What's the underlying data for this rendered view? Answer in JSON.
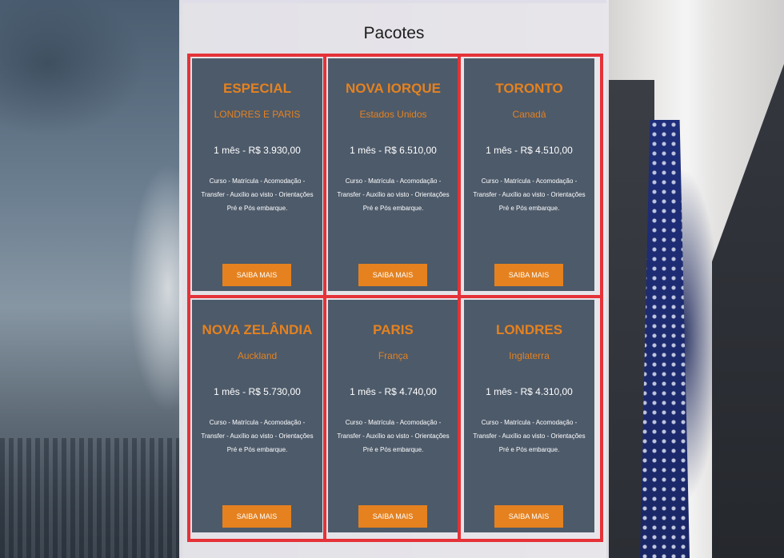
{
  "section_title": "Pacotes",
  "packages": [
    {
      "title": "ESPECIAL",
      "subtitle": "LONDRES E PARIS",
      "price": "1 mês - R$ 3.930,00",
      "description": "Curso - Matrícula - Acomodação - Transfer - Auxílio ao visto - Orientações Pré e Pós embarque.",
      "button_label": "SAIBA MAIS"
    },
    {
      "title": "NOVA IORQUE",
      "subtitle": "Estados Unidos",
      "price": "1 mês - R$ 6.510,00",
      "description": "Curso - Matrícula - Acomodação - Transfer - Auxílio ao visto - Orientações Pré e Pós embarque.",
      "button_label": "SAIBA MAIS"
    },
    {
      "title": "TORONTO",
      "subtitle": "Canadá",
      "price": "1 mês - R$ 4.510,00",
      "description": "Curso - Matrícula - Acomodação - Transfer - Auxílio ao visto - Orientações Pré e Pós embarque.",
      "button_label": "SAIBA MAIS"
    },
    {
      "title": "NOVA ZELÂNDIA",
      "subtitle": "Auckland",
      "price": "1 mês - R$ 5.730,00",
      "description": "Curso - Matrícula - Acomodação - Transfer - Auxílio ao visto - Orientações Pré e Pós embarque.",
      "button_label": "SAIBA MAIS"
    },
    {
      "title": "PARIS",
      "subtitle": "França",
      "price": "1 mês - R$ 4.740,00",
      "description": "Curso - Matrícula - Acomodação - Transfer - Auxílio ao visto - Orientações Pré e Pós embarque.",
      "button_label": "SAIBA MAIS"
    },
    {
      "title": "LONDRES",
      "subtitle": "Inglaterra",
      "price": "1 mês - R$ 4.310,00",
      "description": "Curso - Matrícula - Acomodação - Transfer - Auxílio ao visto - Orientações Pré e Pós embarque.",
      "button_label": "SAIBA MAIS"
    }
  ],
  "colors": {
    "accent": "#e5821f",
    "card_background": "#4d5a6a",
    "highlight_border": "#e53238",
    "panel_background": "#e9e7ec"
  }
}
